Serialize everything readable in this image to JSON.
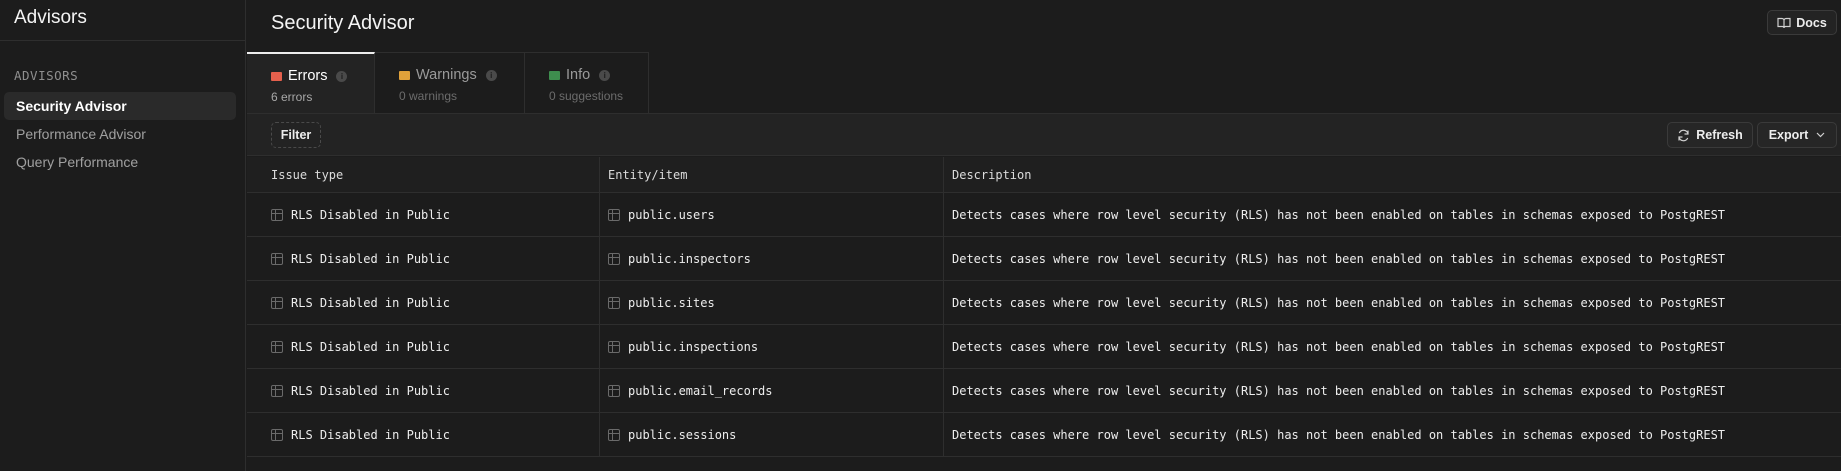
{
  "sidebar": {
    "title": "Advisors",
    "section_label": "ADVISORS",
    "items": [
      {
        "label": "Security Advisor"
      },
      {
        "label": "Performance Advisor"
      },
      {
        "label": "Query Performance"
      }
    ]
  },
  "header": {
    "title": "Security Advisor",
    "docs_label": "Docs"
  },
  "tabs": [
    {
      "label": "Errors",
      "sub": "6 errors",
      "color": "#e5604d"
    },
    {
      "label": "Warnings",
      "sub": "0 warnings",
      "color": "#e0a13a"
    },
    {
      "label": "Info",
      "sub": "0 suggestions",
      "color": "#3e8e4e"
    }
  ],
  "toolbar": {
    "filter_label": "Filter",
    "refresh_label": "Refresh",
    "export_label": "Export"
  },
  "table": {
    "columns": [
      "Issue type",
      "Entity/item",
      "Description"
    ],
    "rows": [
      {
        "issue": "RLS Disabled in Public",
        "entity": "public.users",
        "description": "Detects cases where row level security (RLS) has not been enabled on tables in schemas exposed to PostgREST"
      },
      {
        "issue": "RLS Disabled in Public",
        "entity": "public.inspectors",
        "description": "Detects cases where row level security (RLS) has not been enabled on tables in schemas exposed to PostgREST"
      },
      {
        "issue": "RLS Disabled in Public",
        "entity": "public.sites",
        "description": "Detects cases where row level security (RLS) has not been enabled on tables in schemas exposed to PostgREST"
      },
      {
        "issue": "RLS Disabled in Public",
        "entity": "public.inspections",
        "description": "Detects cases where row level security (RLS) has not been enabled on tables in schemas exposed to PostgREST"
      },
      {
        "issue": "RLS Disabled in Public",
        "entity": "public.email_records",
        "description": "Detects cases where row level security (RLS) has not been enabled on tables in schemas exposed to PostgREST"
      },
      {
        "issue": "RLS Disabled in Public",
        "entity": "public.sessions",
        "description": "Detects cases where row level security (RLS) has not been enabled on tables in schemas exposed to PostgREST"
      }
    ]
  }
}
